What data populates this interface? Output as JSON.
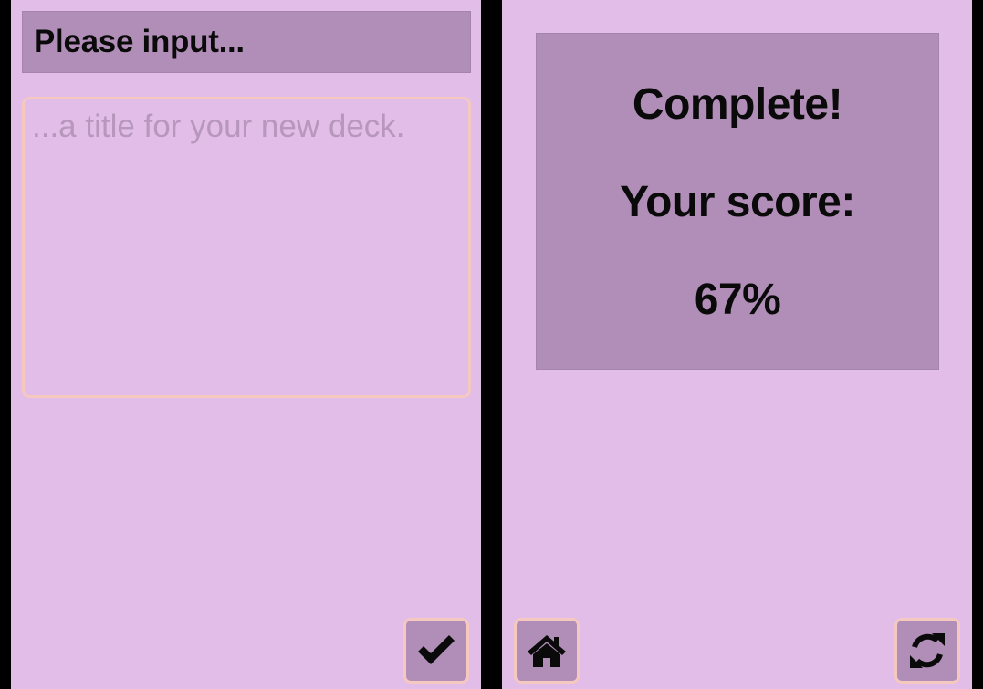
{
  "input_screen": {
    "header": {
      "title": "Please input..."
    },
    "deck_title_input": {
      "value": "",
      "placeholder": "...a title for your new deck."
    },
    "confirm_button": {
      "icon": "check-icon"
    }
  },
  "result_screen": {
    "heading": "Complete!",
    "score_label": "Your score:",
    "score_value": "67%",
    "home_button": {
      "icon": "home-icon"
    },
    "restart_button": {
      "icon": "refresh-icon"
    }
  },
  "colors": {
    "background": "#e1bde8",
    "panel": "#b18eb7",
    "accent_border": "#f5c8c0",
    "text": "#0a0a0a",
    "placeholder": "#b797bc",
    "divider": "#000000"
  }
}
